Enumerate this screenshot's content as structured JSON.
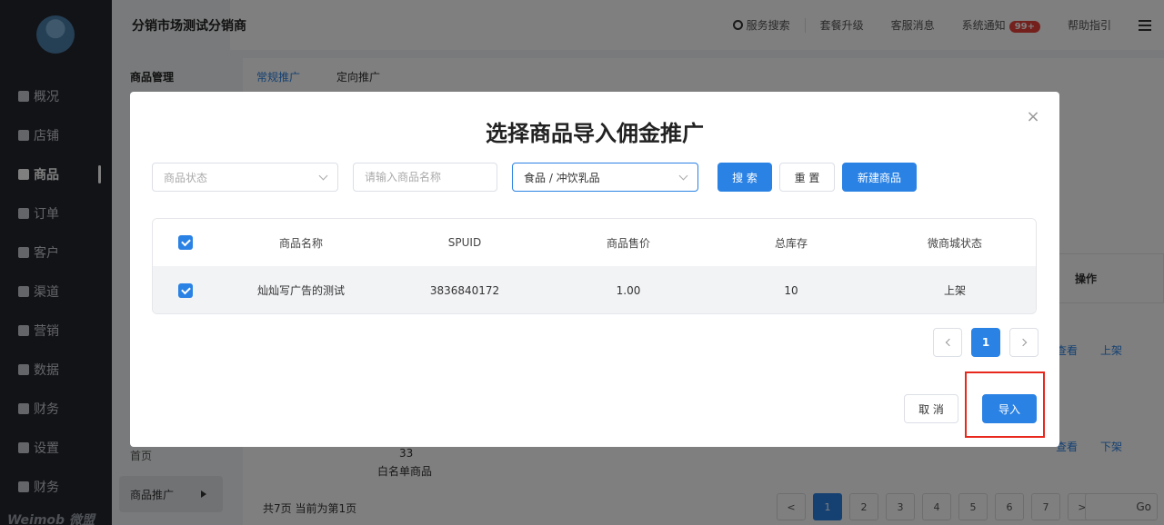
{
  "sidebar": {
    "items": [
      {
        "label": "概况",
        "icon": "overview-icon"
      },
      {
        "label": "店铺",
        "icon": "store-icon"
      },
      {
        "label": "商品",
        "icon": "goods-icon",
        "active": true
      },
      {
        "label": "订单",
        "icon": "order-icon"
      },
      {
        "label": "客户",
        "icon": "customer-icon"
      },
      {
        "label": "渠道",
        "icon": "channel-icon"
      },
      {
        "label": "营销",
        "icon": "marketing-icon"
      },
      {
        "label": "数据",
        "icon": "data-icon"
      },
      {
        "label": "财务",
        "icon": "finance-icon"
      },
      {
        "label": "设置",
        "icon": "settings-icon"
      },
      {
        "label": "财务",
        "icon": "finance-icon"
      }
    ],
    "brand": "Weimob 微盟"
  },
  "subnav": {
    "heading": "商品管理",
    "home": "首页",
    "promo": "商品推广"
  },
  "header": {
    "title": "分销市场测试分销商",
    "links": {
      "search": "服务搜索",
      "upgrade": "套餐升级",
      "service_msg": "客服消息",
      "notice": "系统通知",
      "notice_badge": "99+",
      "help": "帮助指引"
    }
  },
  "background": {
    "tabs": [
      "常规推广",
      "定向推广"
    ],
    "op_header": "操作",
    "row1_actions": [
      "查看",
      "上架"
    ],
    "row2_actions": [
      "查看",
      "下架"
    ],
    "row2_text1": "33",
    "row2_text2": "白名单商品",
    "footer": "共7页 当前为第1页",
    "pages": [
      "1",
      "2",
      "3",
      "4",
      "5",
      "6",
      "7"
    ],
    "go_label": "Go"
  },
  "modal": {
    "title": "选择商品导入佣金推广",
    "filters": {
      "status_placeholder": "商品状态",
      "name_placeholder": "请输入商品名称",
      "category_value": "食品 / 冲饮乳品"
    },
    "buttons": {
      "search": "搜 索",
      "reset": "重 置",
      "new": "新建商品",
      "cancel": "取 消",
      "import": "导入"
    },
    "table": {
      "columns": [
        "商品名称",
        "SPUID",
        "商品售价",
        "总库存",
        "微商城状态"
      ],
      "rows": [
        {
          "name": "灿灿写广告的测试",
          "spuid": "3836840172",
          "price": "1.00",
          "stock": "10",
          "status": "上架",
          "checked": true
        }
      ]
    },
    "pagination": {
      "current": "1"
    }
  },
  "colors": {
    "primary": "#2a82e4",
    "highlight": "#e8281d",
    "sidebar_bg": "#24272e"
  }
}
